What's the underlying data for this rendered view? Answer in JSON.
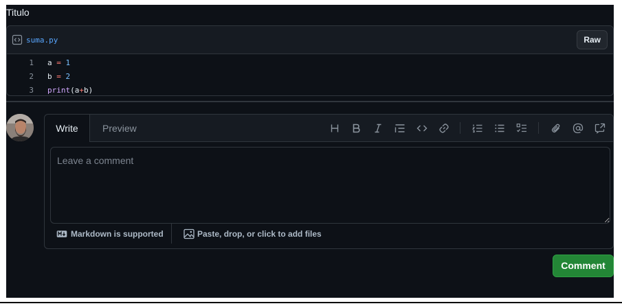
{
  "page": {
    "title": "Titulo"
  },
  "gist": {
    "file_icon": "code-square-icon",
    "file_name": "suma.py",
    "raw_label": "Raw",
    "lines": [
      {
        "num": "1",
        "tokens": [
          {
            "t": "a",
            "c": "var"
          },
          {
            "t": " = ",
            "c": "op"
          },
          {
            "t": "1",
            "c": "num"
          }
        ]
      },
      {
        "num": "2",
        "tokens": [
          {
            "t": "b",
            "c": "var"
          },
          {
            "t": " = ",
            "c": "op"
          },
          {
            "t": "2",
            "c": "num"
          }
        ]
      },
      {
        "num": "3",
        "tokens": [
          {
            "t": "print",
            "c": "fn"
          },
          {
            "t": "(a",
            "c": "var"
          },
          {
            "t": "+",
            "c": "op"
          },
          {
            "t": "b)",
            "c": "var"
          }
        ]
      }
    ]
  },
  "composer": {
    "tabs": {
      "write": "Write",
      "preview": "Preview"
    },
    "toolbar": [
      "heading-icon",
      "bold-icon",
      "italic-icon",
      "quote-icon",
      "code-icon",
      "link-icon",
      "numbered-list-icon",
      "unordered-list-icon",
      "task-list-icon",
      "attach-icon",
      "mention-icon",
      "reference-icon"
    ],
    "placeholder": "Leave a comment",
    "markdown_hint": "Markdown is supported",
    "attach_hint": "Paste, drop, or click to add files",
    "submit_label": "Comment"
  },
  "colors": {
    "background": "#0d1117",
    "border": "#30363d",
    "link": "#58a6ff",
    "submit": "#238636"
  }
}
